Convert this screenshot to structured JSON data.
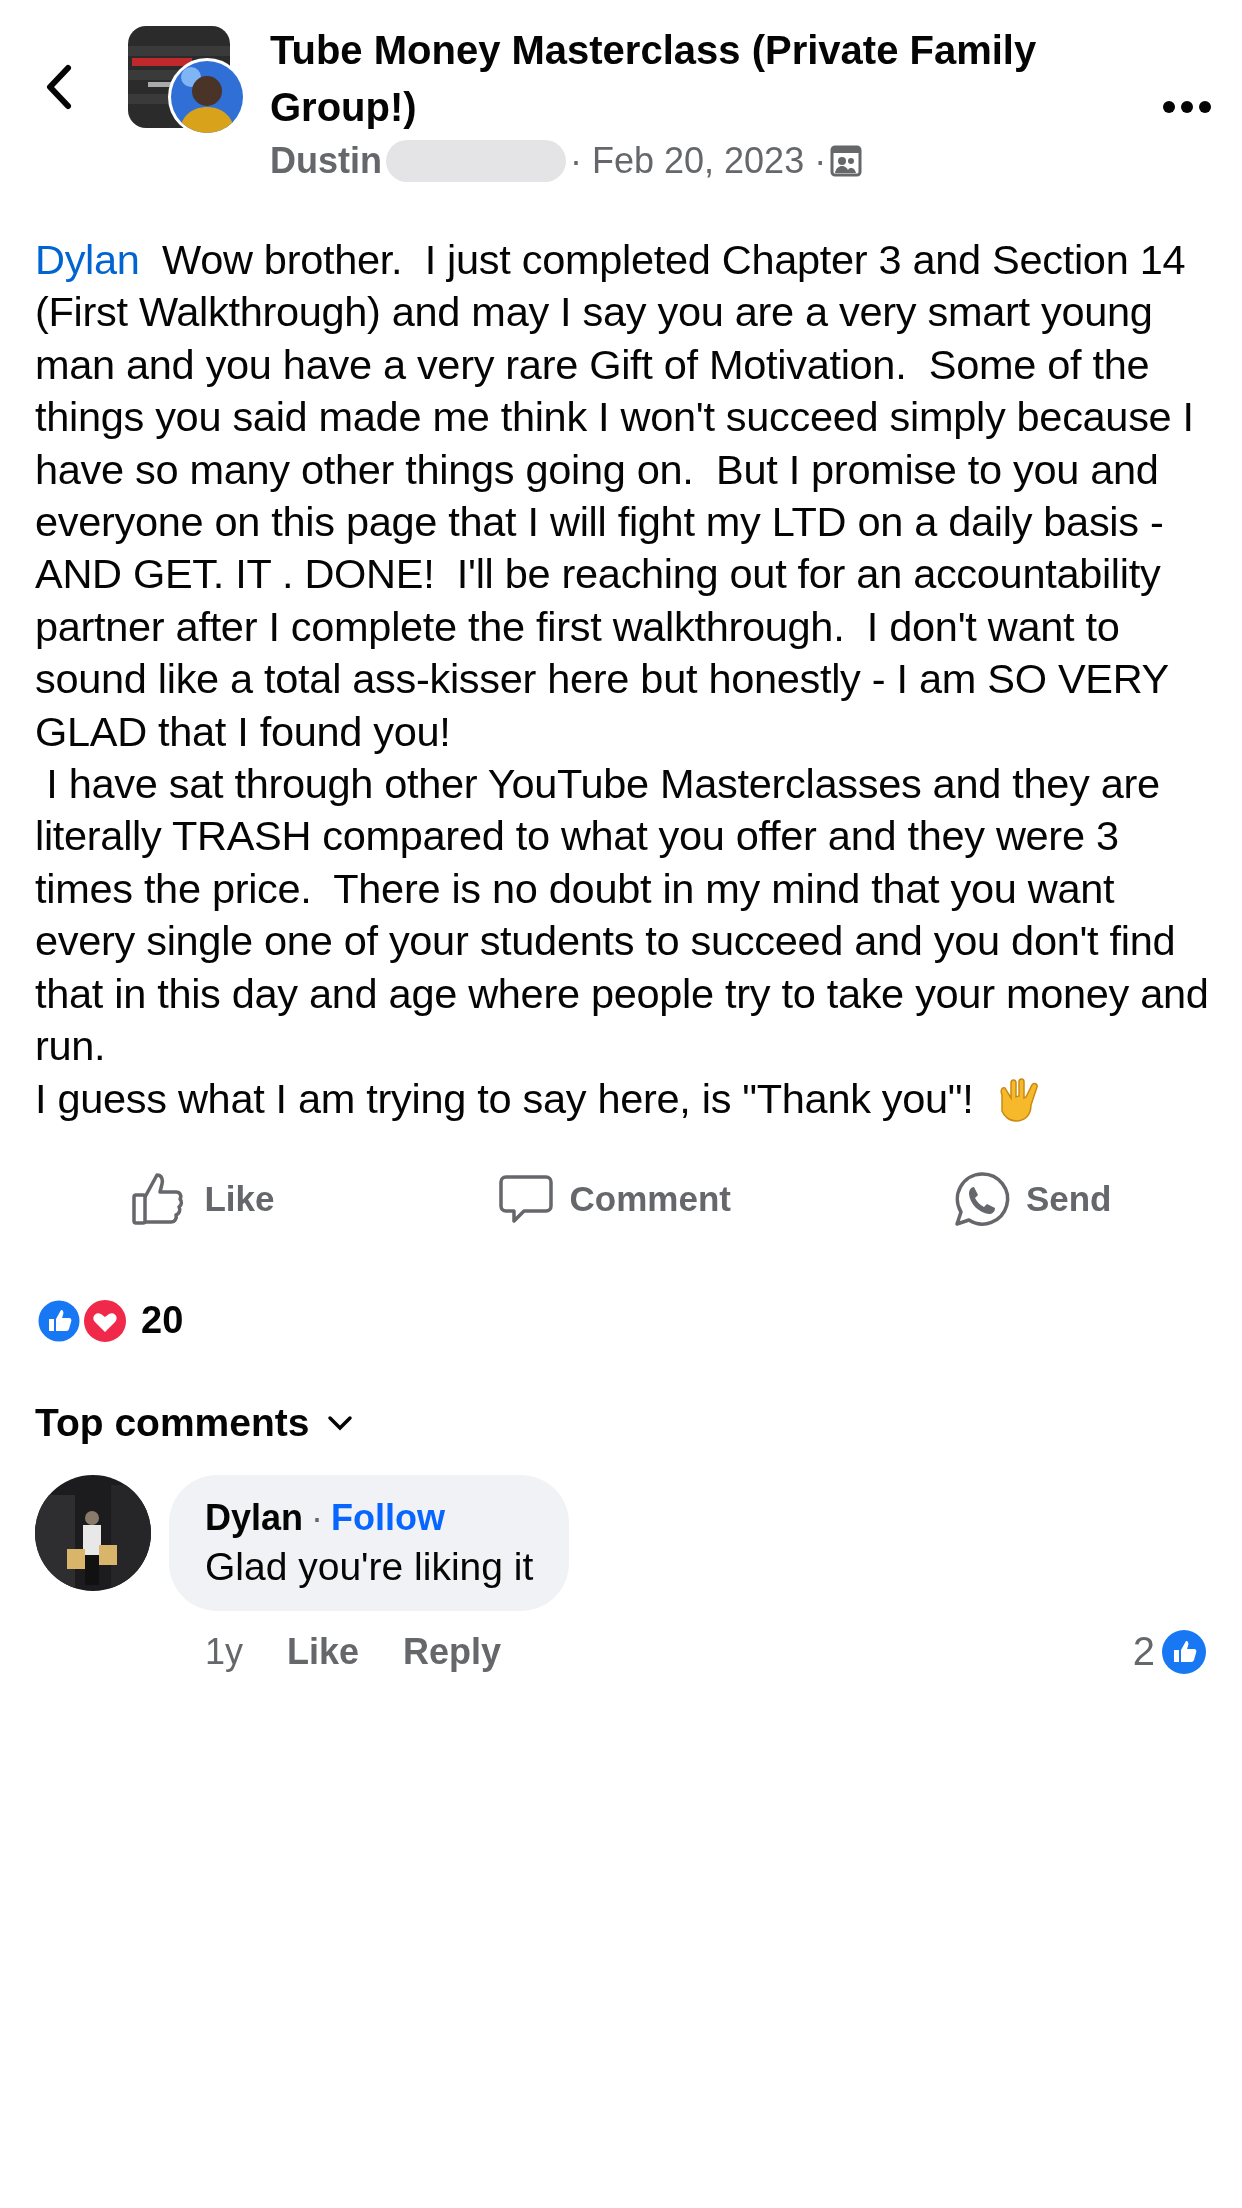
{
  "header": {
    "group_name": "Tube Money Masterclass (Private Family Group!)",
    "author": "Dustin",
    "date": "· Feb 20, 2023 ·"
  },
  "post": {
    "mention": "Dylan",
    "paragraphs": [
      "  Wow brother.  I just completed Chapter 3 and Section 14 (First Walkthrough) and may I say you are a very smart young man and you have a very rare Gift of Motivation.  Some of the things you said made me think I won't succeed simply because I have so many other things going on.  But I promise to you and everyone on this page that I will fight my LTD on a daily basis - AND GET. IT . DONE!  I'll be reaching out for an accountability partner after I complete the first walkthrough.  I don't want to sound like a total ass-kisser here but honestly - I am SO VERY GLAD that I found you!",
      " I have sat through other YouTube Masterclasses and they are literally TRASH compared to what you offer and they were 3 times the price.  There is no doubt in my mind that you want every single one of your students to succeed and you don't find that in this day and age where people try to take your money and run.",
      "I guess what I am trying to say here, is \"Thank you\"!  "
    ]
  },
  "actions": [
    {
      "kind": "like",
      "label": "Like"
    },
    {
      "kind": "comment",
      "label": "Comment"
    },
    {
      "kind": "send",
      "label": "Send"
    }
  ],
  "reactions": {
    "count": "20"
  },
  "comments_sort": "Top comments",
  "comments": [
    {
      "author": "Dylan",
      "separator": "·",
      "follow": "Follow",
      "text": "Glad you're liking it",
      "time": "1y",
      "like": "Like",
      "reply": "Reply",
      "likes": "2"
    }
  ]
}
